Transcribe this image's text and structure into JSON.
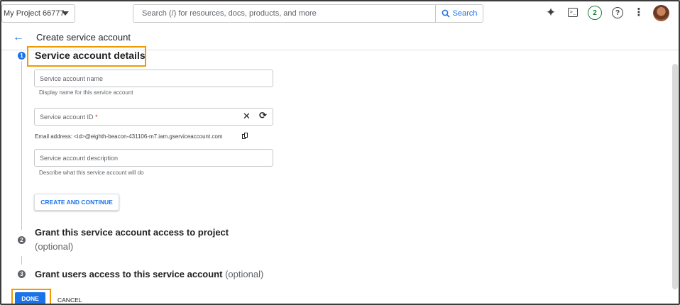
{
  "topbar": {
    "project": "My Project 66777",
    "search_placeholder": "Search (/) for resources, docs, products, and more",
    "search_button": "Search",
    "notifications_count": "2",
    "icons": [
      "gemini-sparkle-icon",
      "cloud-shell-terminal-icon",
      "help-icon",
      "more-vert-icon",
      "avatar"
    ]
  },
  "header": {
    "title": "Create service account"
  },
  "steps": [
    {
      "number": "1",
      "title": "Service account details"
    },
    {
      "number": "2",
      "title": "Grant this service account access to project",
      "optional": "(optional)"
    },
    {
      "number": "3",
      "title": "Grant users access to this service account",
      "optional": "(optional)"
    }
  ],
  "form": {
    "name_placeholder": "Service account name",
    "name_hint": "Display name for this service account",
    "id_placeholder": "Service account ID",
    "id_required_marker": "*",
    "email_text": "Email address: <id>@eighth-beacon-431106-m7.iam.gserviceaccount.com",
    "description_placeholder": "Service account description",
    "description_hint": "Describe what this service account will do",
    "create_button": "CREATE AND CONTINUE"
  },
  "footer": {
    "done_button": "DONE",
    "cancel_button": "CANCEL"
  },
  "colors": {
    "accent": "#1a73e8",
    "highlight": "#f29900",
    "badge_green": "#188038"
  }
}
